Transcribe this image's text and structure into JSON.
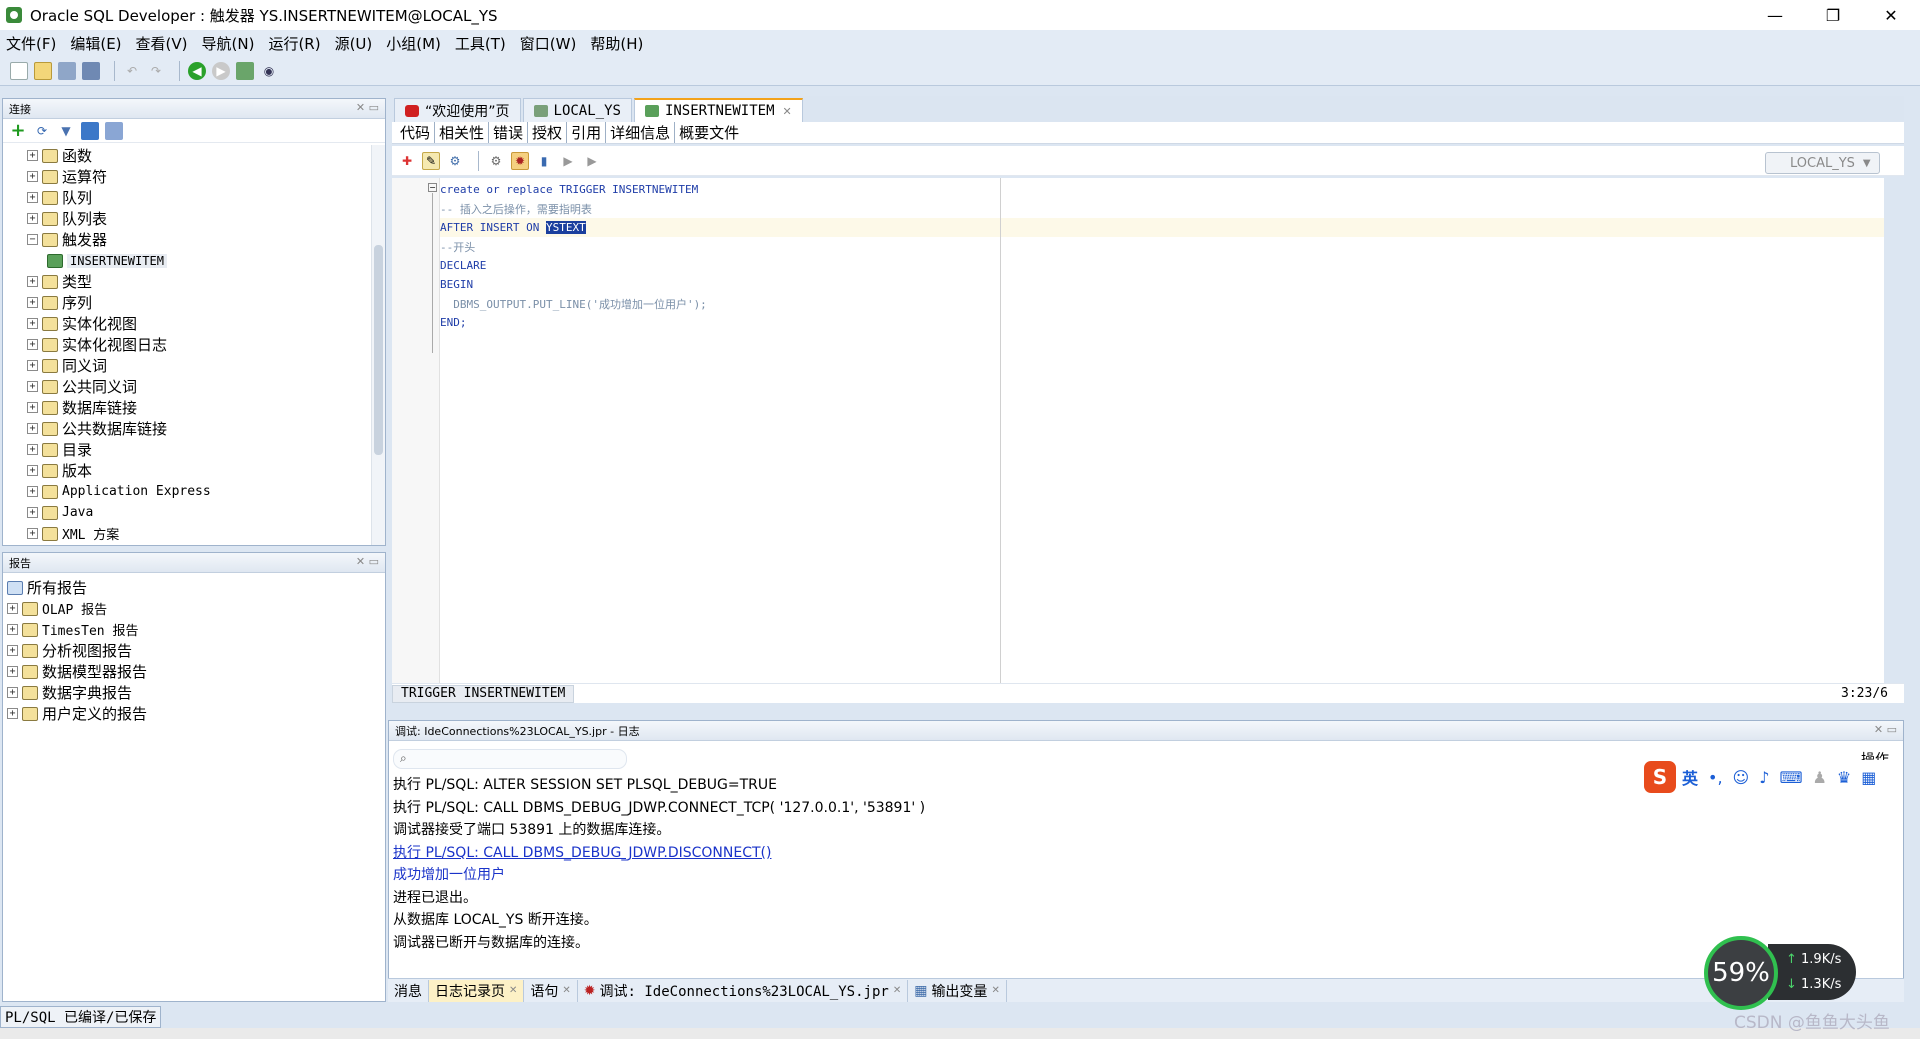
{
  "window": {
    "title": "Oracle SQL Developer : 触发器 YS.INSERTNEWITEM@LOCAL_YS",
    "minimize": "—",
    "restore": "❐",
    "close": "✕"
  },
  "menu": [
    "文件(F)",
    "编辑(E)",
    "查看(V)",
    "导航(N)",
    "运行(R)",
    "源(U)",
    "小组(M)",
    "工具(T)",
    "窗口(W)",
    "帮助(H)"
  ],
  "connections_panel": {
    "title": "连接",
    "items": [
      {
        "label": "函数",
        "expanded": false,
        "indent": 0
      },
      {
        "label": "运算符",
        "expanded": false,
        "indent": 0
      },
      {
        "label": "队列",
        "expanded": false,
        "indent": 0
      },
      {
        "label": "队列表",
        "expanded": false,
        "indent": 0
      },
      {
        "label": "触发器",
        "expanded": true,
        "indent": 0
      },
      {
        "label": "INSERTNEWITEM",
        "expanded": null,
        "indent": 1
      },
      {
        "label": "类型",
        "expanded": false,
        "indent": 0
      },
      {
        "label": "序列",
        "expanded": false,
        "indent": 0
      },
      {
        "label": "实体化视图",
        "expanded": false,
        "indent": 0
      },
      {
        "label": "实体化视图日志",
        "expanded": false,
        "indent": 0
      },
      {
        "label": "同义词",
        "expanded": false,
        "indent": 0
      },
      {
        "label": "公共同义词",
        "expanded": false,
        "indent": 0
      },
      {
        "label": "数据库链接",
        "expanded": false,
        "indent": 0
      },
      {
        "label": "公共数据库链接",
        "expanded": false,
        "indent": 0
      },
      {
        "label": "目录",
        "expanded": false,
        "indent": 0
      },
      {
        "label": "版本",
        "expanded": false,
        "indent": 0
      },
      {
        "label": "Application Express",
        "expanded": false,
        "indent": 0
      },
      {
        "label": "Java",
        "expanded": false,
        "indent": 0
      },
      {
        "label": "XML 方案",
        "expanded": false,
        "indent": 0
      }
    ]
  },
  "reports_panel": {
    "title": "报告",
    "root": "所有报告",
    "items": [
      "OLAP 报告",
      "TimesTen 报告",
      "分析视图报告",
      "数据模型器报告",
      "数据字典报告",
      "用户定义的报告"
    ]
  },
  "editor": {
    "tabs": [
      {
        "label": "“欢迎使用”页",
        "active": false
      },
      {
        "label": "LOCAL_YS",
        "active": false
      },
      {
        "label": "INSERTNEWITEM",
        "active": true
      }
    ],
    "subtabs": [
      "代码",
      "相关性",
      "错误",
      "授权",
      "引用",
      "详细信息",
      "概要文件"
    ],
    "connection": "LOCAL_YS",
    "code": [
      {
        "kind": "kw",
        "text": "create or replace TRIGGER INSERTNEWITEM",
        "rest": ""
      },
      {
        "kind": "cmt",
        "text": "-- 插入之后操作，需要指明表",
        "rest": ""
      },
      {
        "kind": "kw",
        "text": "AFTER INSERT ON ",
        "rest": "YSTEXT"
      },
      {
        "kind": "cmt",
        "text": "--开头",
        "rest": ""
      },
      {
        "kind": "kw",
        "text": "DECLARE",
        "rest": ""
      },
      {
        "kind": "kw",
        "text": "BEGIN",
        "rest": ""
      },
      {
        "kind": "cmt",
        "text": "  DBMS_OUTPUT.PUT_LINE('成功增加一位用户');",
        "rest": ""
      },
      {
        "kind": "kw",
        "text": "END;",
        "rest": ""
      }
    ],
    "status_tab": "TRIGGER INSERTNEWITEM",
    "cursor_pos": "3:23/6"
  },
  "log": {
    "title": "调试: IdeConnections%23LOCAL_YS.jpr - 日志",
    "actions_label": "操作",
    "lines": [
      {
        "text": "执行 PL/SQL: ALTER SESSION SET PLSQL_DEBUG=TRUE",
        "style": "normal"
      },
      {
        "text": "执行 PL/SQL: CALL DBMS_DEBUG_JDWP.CONNECT_TCP( '127.0.0.1', '53891' )",
        "style": "normal"
      },
      {
        "text": "调试器接受了端口 53891 上的数据库连接。",
        "style": "normal"
      },
      {
        "text": "执行 PL/SQL: CALL DBMS_DEBUG_JDWP.DISCONNECT()",
        "style": "link"
      },
      {
        "text": "成功增加一位用户",
        "style": "blue"
      },
      {
        "text": "进程已退出。",
        "style": "normal"
      },
      {
        "text": "从数据库 LOCAL_YS 断开连接。",
        "style": "normal"
      },
      {
        "text": "调试器已断开与数据库的连接。",
        "style": "normal"
      }
    ],
    "tabs": [
      {
        "label": "消息",
        "active": false
      },
      {
        "label": "日志记录页",
        "active": true
      },
      {
        "label": "语句",
        "active": false
      },
      {
        "label": "调试: IdeConnections%23LOCAL_YS.jpr",
        "active": false
      },
      {
        "label": "输出变量",
        "active": false
      }
    ]
  },
  "status_bar": "PL/SQL 已编译/已保存",
  "ime": {
    "logo": "S",
    "lang": "英"
  },
  "netmon": {
    "percent": "59%",
    "up": "1.9K/s",
    "down": "1.3K/s"
  },
  "watermark": "CSDN @鱼鱼大头鱼"
}
